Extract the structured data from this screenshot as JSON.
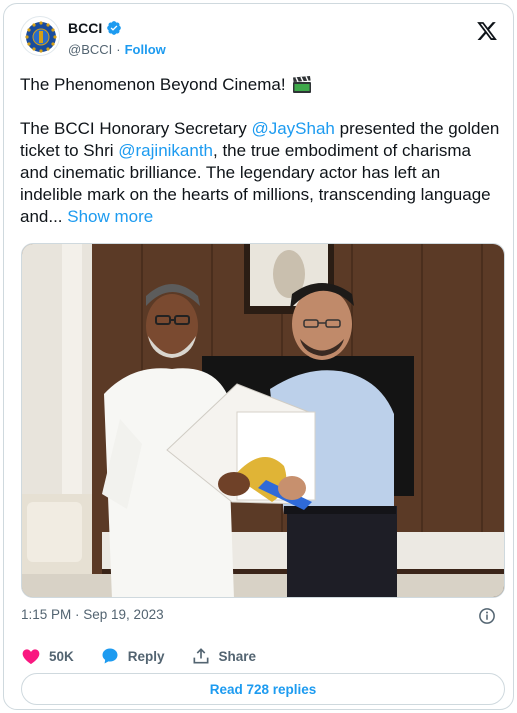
{
  "author": {
    "name": "BCCI",
    "handle": "@BCCI",
    "separator": "·",
    "follow_label": "Follow"
  },
  "tweet": {
    "title": "The Phenomenon Beyond Cinema!",
    "segments": [
      {
        "text": "The BCCI Honorary Secretary ",
        "type": "text"
      },
      {
        "text": "@JayShah",
        "type": "mention"
      },
      {
        "text": " presented the golden ticket to Shri ",
        "type": "text"
      },
      {
        "text": "@rajinikanth",
        "type": "mention"
      },
      {
        "text": ", the true embodiment of charisma and cinematic brilliance. The legendary actor has left an indelible mark on the hearts of millions, transcending language and... ",
        "type": "text"
      },
      {
        "text": "Show more",
        "type": "more"
      }
    ],
    "timestamp": "1:15 PM · Sep 19, 2023"
  },
  "actions": {
    "likes": "50K",
    "reply_label": "Reply",
    "share_label": "Share"
  },
  "replies_button": "Read 728 replies",
  "colors": {
    "accent": "#1d9bf0",
    "like": "#f91880",
    "muted": "#536471"
  }
}
